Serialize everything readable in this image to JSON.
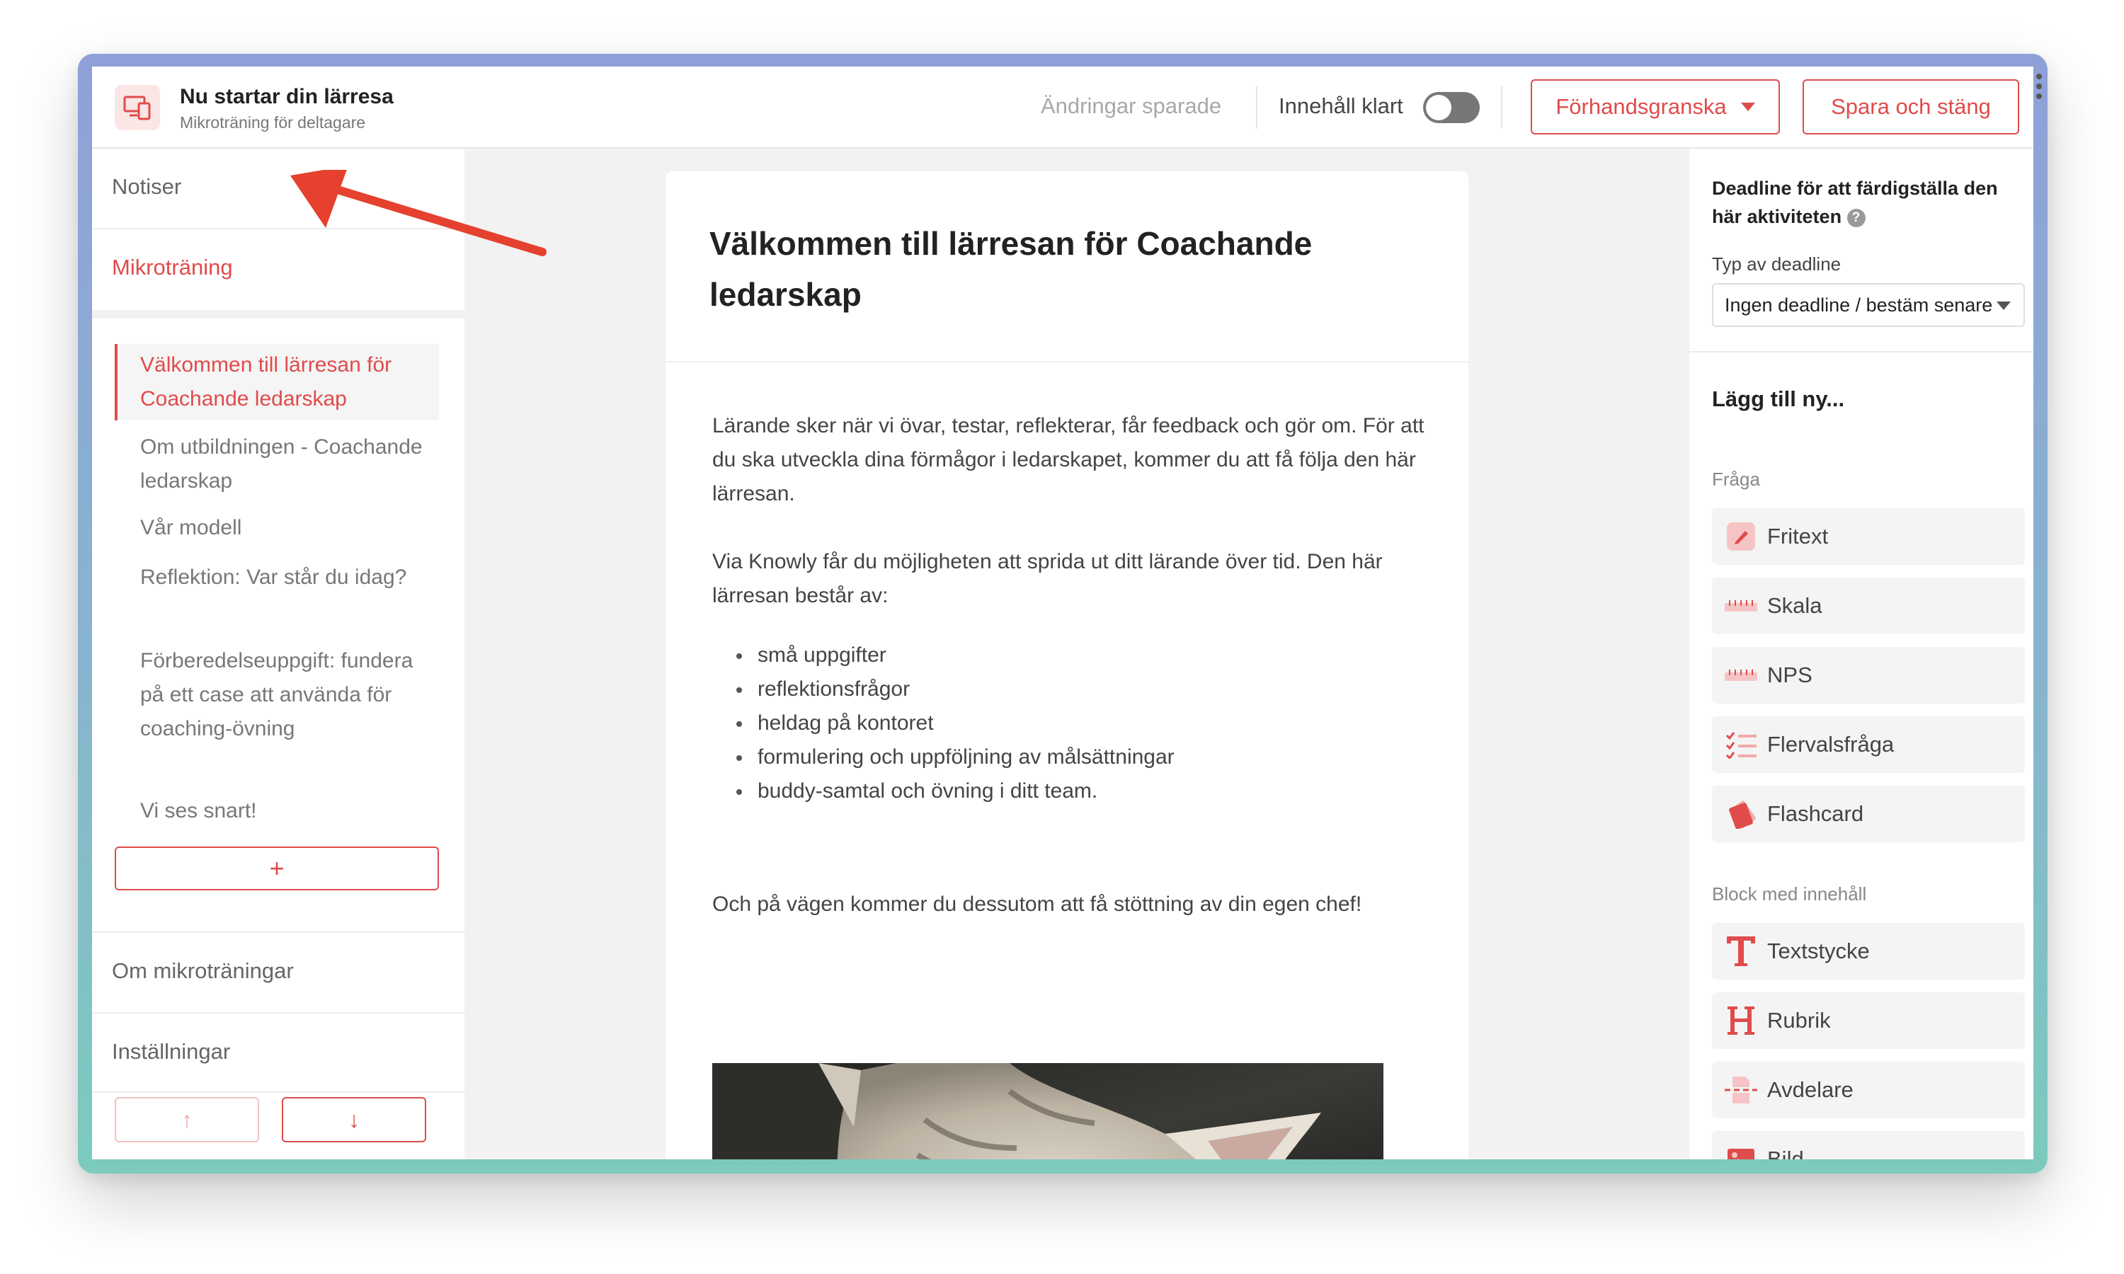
{
  "header": {
    "title": "Nu startar din lärresa",
    "subtitle": "Mikroträning för deltagare",
    "saved_status": "Ändringar sparade",
    "content_ready_label": "Innehåll klart",
    "content_ready_on": false,
    "preview_label": "Förhandsgranska",
    "save_close_label": "Spara och stäng"
  },
  "sidebar": {
    "notices_label": "Notiser",
    "microtraining_label": "Mikroträning",
    "steps": [
      "Välkommen till lärresan för Coachande ledarskap",
      "Om utbildningen - Coachande ledarskap",
      "Vår modell",
      "Reflektion: Var står du idag?",
      "Förberedelseuppgift: fundera på ett case att använda för coaching-övning",
      "Vi ses snart!"
    ],
    "add_label": "+",
    "about_label": "Om mikroträningar",
    "settings_label": "Inställningar",
    "move_up_label": "↑",
    "move_down_label": "↓"
  },
  "document": {
    "title": "Välkommen till lärresan för Coachande ledarskap",
    "paragraph1": "Lärande sker när vi övar, testar, reflekterar, får feedback och gör om. För att du ska utveckla dina förmågor i ledarskapet, kommer du att få följa den här lärresan.",
    "paragraph2": "Via Knowly får du möjligheten att sprida ut ditt lärande över tid. Den här lärresan består av:",
    "bullets": [
      "små uppgifter",
      "reflektionsfrågor",
      "heldag på kontoret",
      "formulering och uppföljning av målsättningar",
      "buddy-samtal och övning i ditt team."
    ],
    "paragraph3": "Och på vägen kommer du dessutom att få stöttning av din egen chef!"
  },
  "panel": {
    "deadline_title": "Deadline för att färdigställa den här aktiviteten",
    "help_icon": "?",
    "deadline_type_label": "Typ av deadline",
    "deadline_type_value": "Ingen deadline / bestäm senare",
    "add_new_title": "Lägg till ny...",
    "question_group_label": "Fråga",
    "question_items": [
      {
        "label": "Fritext",
        "icon": "pencil-icon"
      },
      {
        "label": "Skala",
        "icon": "ruler-icon"
      },
      {
        "label": "NPS",
        "icon": "ruler-icon"
      },
      {
        "label": "Flervalsfråga",
        "icon": "checklist-icon"
      },
      {
        "label": "Flashcard",
        "icon": "flashcard-icon"
      }
    ],
    "content_group_label": "Block med innehåll",
    "content_items": [
      {
        "label": "Textstycke",
        "icon": "text-t-icon"
      },
      {
        "label": "Rubrik",
        "icon": "heading-h-icon"
      },
      {
        "label": "Avdelare",
        "icon": "divider-icon"
      },
      {
        "label": "Bild",
        "icon": "image-icon"
      }
    ]
  },
  "colors": {
    "accent": "#e04b4b",
    "annotation_arrow": "#e5412e",
    "toggle_off": "#777777"
  }
}
